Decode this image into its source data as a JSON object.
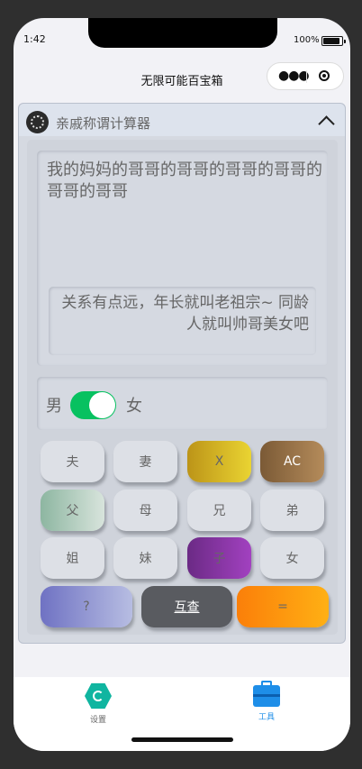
{
  "status": {
    "time": "1:42",
    "battery": "100%"
  },
  "nav": {
    "title": "无限可能百宝箱"
  },
  "calculator": {
    "title": "亲戚称谓计算器",
    "input": "我的妈妈的哥哥的哥哥的哥哥的哥哥的哥哥的哥哥",
    "result": "关系有点远，年长就叫老祖宗~ 同龄人就叫帅哥美女吧",
    "gender_left": "男",
    "gender_right": "女",
    "gender_toggle_on": true
  },
  "keys": {
    "husband": "夫",
    "wife": "妻",
    "back": "X",
    "clear": "AC",
    "father": "父",
    "mother": "母",
    "elder_brother": "兄",
    "younger_brother": "弟",
    "elder_sister": "姐",
    "younger_sister": "妹",
    "son": "子",
    "daughter": "女",
    "question": "?",
    "mutual": "互查",
    "equals": "="
  },
  "tabs": [
    {
      "label": "设置",
      "icon": "settings-hex-icon",
      "color": "#666666"
    },
    {
      "label": "工具",
      "icon": "toolbox-icon",
      "color": "#1e8ee8"
    }
  ]
}
